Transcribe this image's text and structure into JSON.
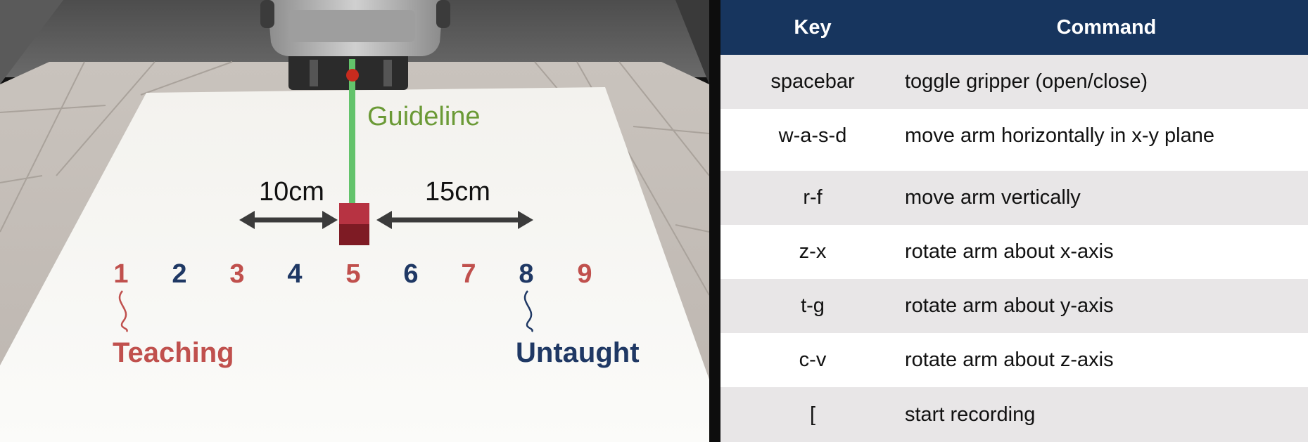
{
  "scene": {
    "guideline_label": "Guideline",
    "left_distance_label": "10cm",
    "right_distance_label": "15cm",
    "position_numbers": [
      "1",
      "2",
      "3",
      "4",
      "5",
      "6",
      "7",
      "8",
      "9"
    ],
    "teaching_label": "Teaching",
    "untaught_label": "Untaught",
    "colors": {
      "teaching": "#c0504d",
      "untaught": "#1f3864",
      "guideline": "#6b9a36",
      "cube": "#a52a36"
    }
  },
  "table": {
    "headers": [
      "Key",
      "Command"
    ],
    "rows": [
      {
        "key": "spacebar",
        "command": "toggle gripper (open/close)"
      },
      {
        "key": "w-a-s-d",
        "command": "move arm horizontally in x-y plane"
      },
      {
        "key": "r-f",
        "command": "move arm vertically"
      },
      {
        "key": "z-x",
        "command": "rotate arm about x-axis"
      },
      {
        "key": "t-g",
        "command": "rotate arm about y-axis"
      },
      {
        "key": "c-v",
        "command": "rotate arm about z-axis"
      },
      {
        "key": "[",
        "command": "start recording"
      }
    ],
    "colors": {
      "header_bg": "#17355e",
      "shade_row": "#e8e6e7"
    }
  }
}
